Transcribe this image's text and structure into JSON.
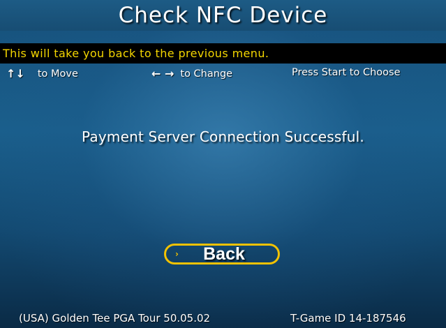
{
  "header": {
    "title": "Check NFC Device"
  },
  "help": {
    "text": "This will take you back to the previous menu."
  },
  "controls": {
    "move_icon": "↑↓",
    "move_label": "to Move",
    "change_icon": "← →",
    "change_label": "to Change",
    "choose_label": "Press Start to Choose"
  },
  "main": {
    "message": "Payment Server Connection Successful.",
    "back_label": "Back",
    "back_chevron": "›"
  },
  "footer": {
    "game_info": "(USA) Golden Tee PGA Tour 50.05.02",
    "terminal_id": "T-Game ID 14-187546"
  },
  "colors": {
    "accent_yellow": "#f2c200",
    "help_text": "#f4d600",
    "background_blue": "#1a5f8c"
  }
}
